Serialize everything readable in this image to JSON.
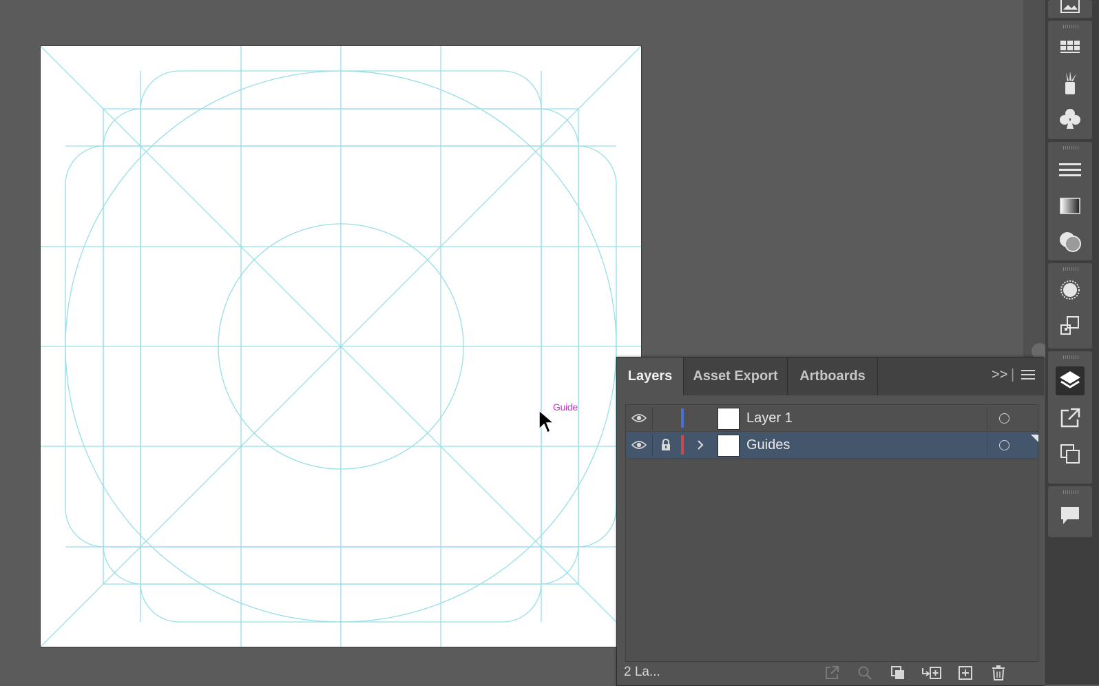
{
  "artboard": {
    "smart_guide_label": "Guide",
    "guide_color": "#95dfe6"
  },
  "dock": {
    "icons": [
      "image-icon",
      "swatch-grid-icon",
      "brushes-icon",
      "symbols-club-icon",
      "stroke-lines-icon",
      "gradient-icon",
      "transparency-icon",
      "appearance-icon",
      "transform-icon",
      "layers-icon",
      "asset-export-icon",
      "artboards-icon",
      "comments-icon"
    ],
    "active": "layers-icon"
  },
  "layers_panel": {
    "tabs": [
      {
        "label": "Layers",
        "active": true
      },
      {
        "label": "Asset Export",
        "active": false
      },
      {
        "label": "Artboards",
        "active": false
      }
    ],
    "collapse_glyph": ">>",
    "layers": [
      {
        "name": "Layer 1",
        "visible": true,
        "locked": false,
        "expandable": false,
        "color": "#4a6fd8",
        "selected": false
      },
      {
        "name": "Guides",
        "visible": true,
        "locked": true,
        "expandable": true,
        "color": "#c94a4a",
        "selected": true
      }
    ],
    "footer": {
      "count_label": "2 La...",
      "buttons": [
        "export-to-assets-icon",
        "locate-object-icon",
        "make-clipping-mask-icon",
        "create-sublayer-icon",
        "create-new-layer-icon",
        "delete-layer-icon"
      ]
    }
  },
  "colors": {
    "app_bg": "#5b5b5b",
    "panel_bg": "#535353",
    "selected_row": "#44566c",
    "smart_guide": "#cc2fd6"
  }
}
